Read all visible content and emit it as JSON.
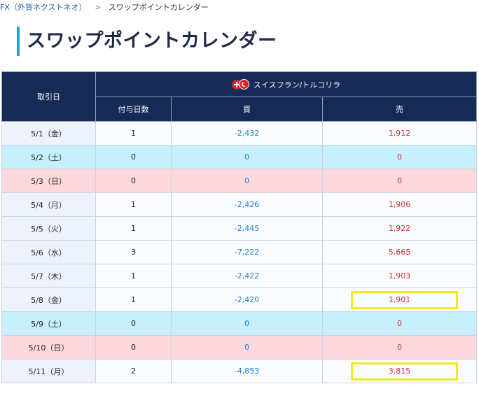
{
  "breadcrumb": {
    "parent": "FX（外貨ネクストネオ）",
    "separator": ">",
    "current": "スワップポイントカレンダー"
  },
  "page_title": "スワップポイントカレンダー",
  "table": {
    "header_date": "取引日",
    "header_pair": "スイスフラン/トルコリラ",
    "header_days": "付与日数",
    "header_buy": "買",
    "header_sell": "売",
    "colors": {
      "header_bg": "#152a55",
      "buy_text": "#1f7fd8",
      "sell_text": "#d43030",
      "saturday_bg": "#c8f0fc",
      "sunday_bg": "#fdd8dc",
      "highlight_border": "#f3ea18"
    },
    "rows": [
      {
        "date": "5/1（金）",
        "days": "1",
        "buy": "-2,432",
        "sell": "1,912",
        "type": "normal",
        "highlight": false
      },
      {
        "date": "5/2（土）",
        "days": "0",
        "buy": "0",
        "sell": "0",
        "type": "sat",
        "highlight": false
      },
      {
        "date": "5/3（日）",
        "days": "0",
        "buy": "0",
        "sell": "0",
        "type": "sun",
        "highlight": false
      },
      {
        "date": "5/4（月）",
        "days": "1",
        "buy": "-2,426",
        "sell": "1,906",
        "type": "normal",
        "highlight": false
      },
      {
        "date": "5/5（火）",
        "days": "1",
        "buy": "-2,445",
        "sell": "1,922",
        "type": "normal",
        "highlight": false
      },
      {
        "date": "5/6（水）",
        "days": "3",
        "buy": "-7,222",
        "sell": "5,665",
        "type": "normal",
        "highlight": false
      },
      {
        "date": "5/7（木）",
        "days": "1",
        "buy": "-2,422",
        "sell": "1,903",
        "type": "normal",
        "highlight": false
      },
      {
        "date": "5/8（金）",
        "days": "1",
        "buy": "-2,420",
        "sell": "1,901",
        "type": "normal",
        "highlight": true
      },
      {
        "date": "5/9（土）",
        "days": "0",
        "buy": "0",
        "sell": "0",
        "type": "sat",
        "highlight": false
      },
      {
        "date": "5/10（日）",
        "days": "0",
        "buy": "0",
        "sell": "0",
        "type": "sun",
        "highlight": false
      },
      {
        "date": "5/11（月）",
        "days": "2",
        "buy": "-4,853",
        "sell": "3,815",
        "type": "normal",
        "highlight": true
      }
    ]
  }
}
